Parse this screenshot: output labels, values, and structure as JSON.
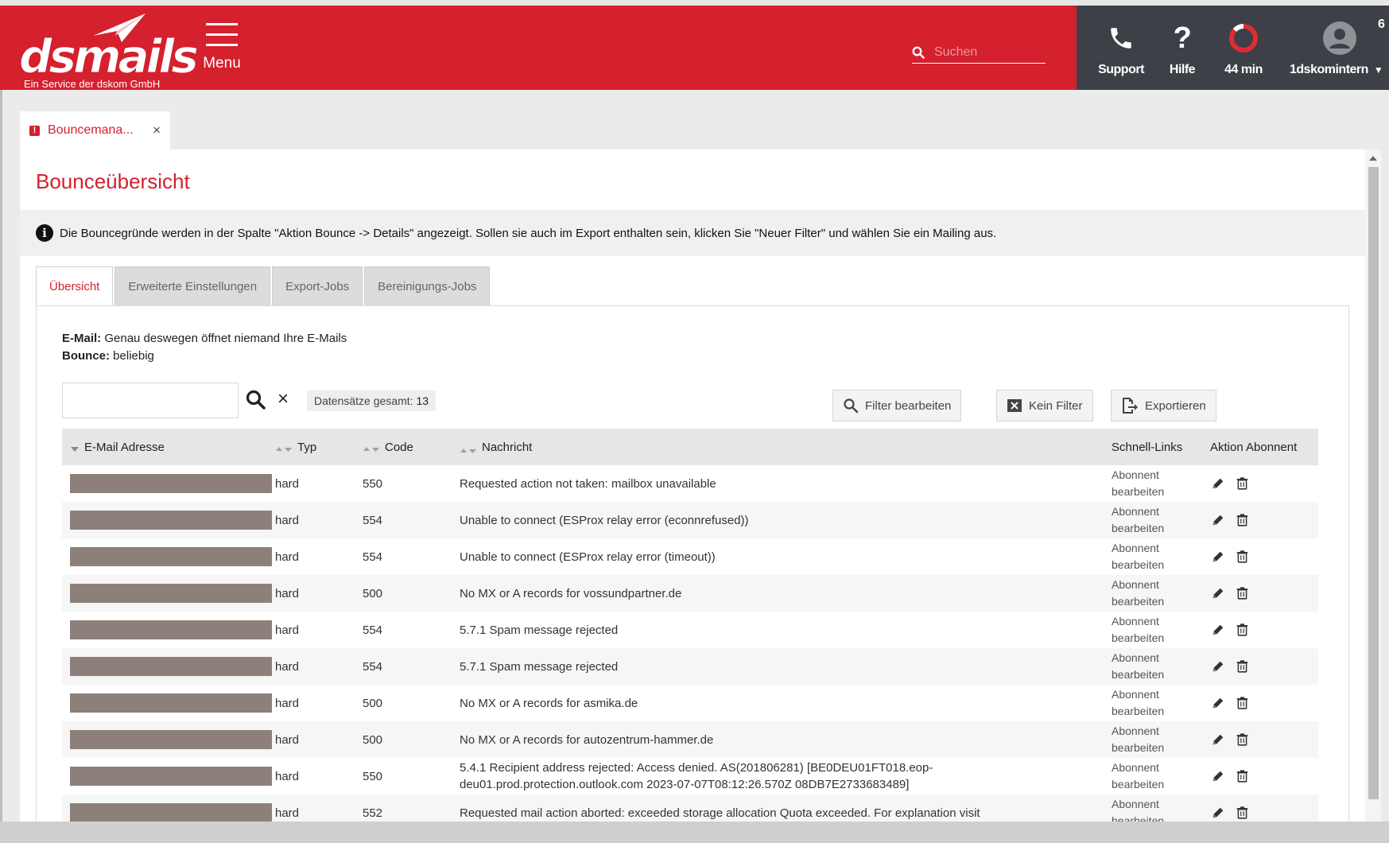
{
  "brand": {
    "logo_text": "dsmails",
    "subtitle": "Ein Service der dskom GmbH"
  },
  "header": {
    "menu_label": "Menu",
    "search_placeholder": "Suchen",
    "support_label": "Support",
    "help_label": "Hilfe",
    "timer_label": "44 min",
    "user_label": "1dskomintern",
    "counter": "6"
  },
  "doc_tab": {
    "label": "Bouncemana...",
    "warning": "!"
  },
  "page": {
    "title": "Bounceübersicht",
    "info_text": "Die Bouncegründe werden in der Spalte \"Aktion Bounce -> Details\" angezeigt. Sollen sie auch im Export enthalten sein, klicken Sie \"Neuer Filter\" und wählen Sie ein Mailing aus."
  },
  "tabs": [
    {
      "label": "Übersicht"
    },
    {
      "label": "Erweiterte Einstellungen"
    },
    {
      "label": "Export-Jobs"
    },
    {
      "label": "Bereinigungs-Jobs"
    }
  ],
  "filter": {
    "email_label": "E-Mail:",
    "email_value": "Genau deswegen öffnet niemand Ihre E-Mails",
    "bounce_label": "Bounce:",
    "bounce_value": "beliebig"
  },
  "toolbar": {
    "records_label": "Datensätze gesamt:",
    "records_count": "13",
    "edit_filter": "Filter bearbeiten",
    "no_filter": "Kein Filter",
    "export": "Exportieren"
  },
  "table": {
    "headers": {
      "email": "E-Mail Adresse",
      "type": "Typ",
      "code": "Code",
      "message": "Nachricht",
      "quick_links": "Schnell-Links",
      "action": "Aktion Abonnent"
    },
    "rows": [
      {
        "type": "hard",
        "code": "550",
        "message": "Requested action not taken: mailbox unavailable",
        "link_line1": "Abonnent",
        "link_line2": "bearbeiten"
      },
      {
        "type": "hard",
        "code": "554",
        "message": "Unable to connect (ESProx relay error (econnrefused))",
        "link_line1": "Abonnent",
        "link_line2": "bearbeiten"
      },
      {
        "type": "hard",
        "code": "554",
        "message": "Unable to connect (ESProx relay error (timeout))",
        "link_line1": "Abonnent",
        "link_line2": "bearbeiten"
      },
      {
        "type": "hard",
        "code": "500",
        "message": "No MX or A records for vossundpartner.de",
        "link_line1": "Abonnent",
        "link_line2": "bearbeiten"
      },
      {
        "type": "hard",
        "code": "554",
        "message": "5.7.1 Spam message rejected",
        "link_line1": "Abonnent",
        "link_line2": "bearbeiten"
      },
      {
        "type": "hard",
        "code": "554",
        "message": "5.7.1 Spam message rejected",
        "link_line1": "Abonnent",
        "link_line2": "bearbeiten"
      },
      {
        "type": "hard",
        "code": "500",
        "message": "No MX or A records for asmika.de",
        "link_line1": "Abonnent",
        "link_line2": "bearbeiten"
      },
      {
        "type": "hard",
        "code": "500",
        "message": "No MX or A records for autozentrum-hammer.de",
        "link_line1": "Abonnent",
        "link_line2": "bearbeiten"
      },
      {
        "type": "hard",
        "code": "550",
        "message": "5.4.1 Recipient address rejected: Access denied. AS(201806281) [BE0DEU01FT018.eop-deu01.prod.protection.outlook.com 2023-07-07T08:12:26.570Z 08DB7E2733683489]",
        "link_line1": "Abonnent",
        "link_line2": "bearbeiten"
      },
      {
        "type": "hard",
        "code": "552",
        "message": "Requested mail action aborted: exceeded storage allocation Quota exceeded. For explanation visit",
        "link_line1": "Abonnent",
        "link_line2": "bearbeiten"
      }
    ]
  },
  "colors": {
    "brand_red": "#d5202e",
    "header_dark": "#3d4046",
    "redaction": "#8d7f7a"
  }
}
